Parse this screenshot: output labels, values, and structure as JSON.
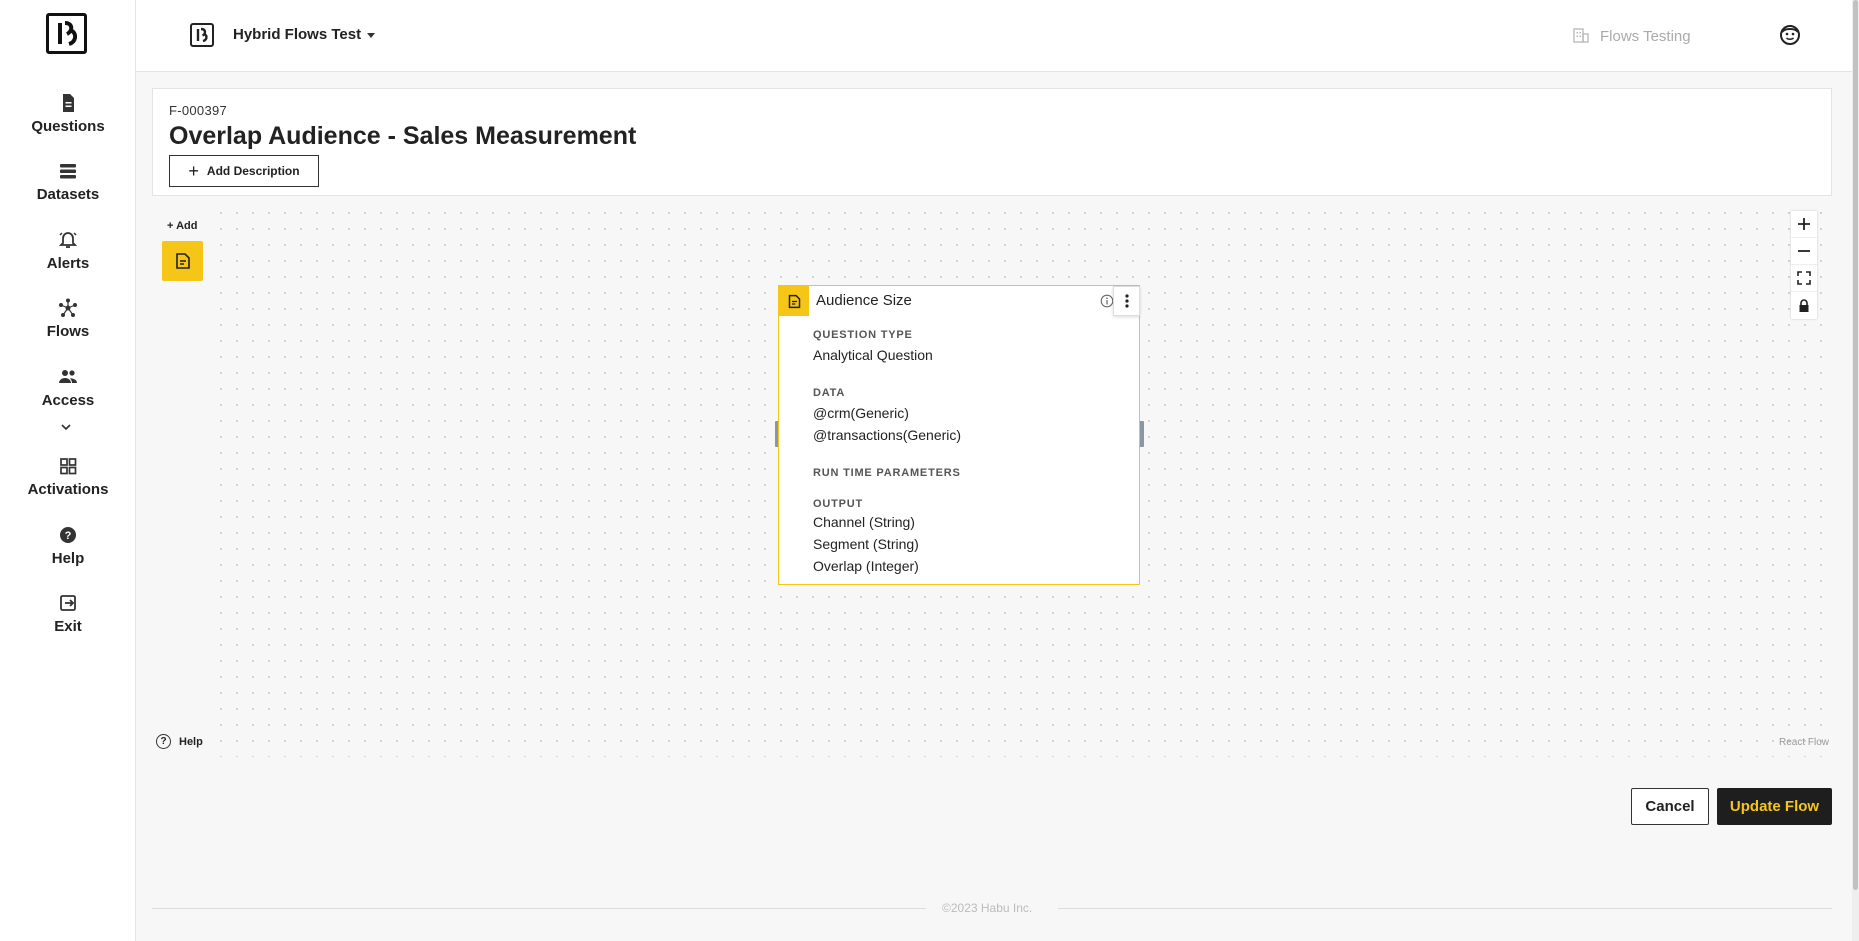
{
  "sidebar": {
    "items": [
      {
        "label": "Questions",
        "icon": "document-icon"
      },
      {
        "label": "Datasets",
        "icon": "stack-icon"
      },
      {
        "label": "Alerts",
        "icon": "bell-icon"
      },
      {
        "label": "Flows",
        "icon": "flows-icon"
      },
      {
        "label": "Access",
        "icon": "people-icon"
      },
      {
        "label": "Activations",
        "icon": "grid-icon"
      },
      {
        "label": "Help",
        "icon": "help-icon"
      },
      {
        "label": "Exit",
        "icon": "exit-icon"
      }
    ]
  },
  "topbar": {
    "org_name": "Hybrid Flows Test",
    "account_name": "Flows Testing"
  },
  "header": {
    "flow_id": "F-000397",
    "title": "Overlap Audience - Sales Measurement",
    "add_description_label": "Add Description"
  },
  "canvas": {
    "add_label": "+ Add",
    "help_label": "Help",
    "attribution": "React Flow",
    "controls": [
      "zoom-in",
      "zoom-out",
      "fit-view",
      "lock"
    ]
  },
  "node": {
    "title": "Audience Size",
    "question_type_label": "QUESTION TYPE",
    "question_type_value": "Analytical Question",
    "data_label": "DATA",
    "data_values": [
      "@crm(Generic)",
      "@transactions(Generic)"
    ],
    "run_time_label": "RUN TIME PARAMETERS",
    "output_label": "OUTPUT",
    "output_values": [
      "Channel (String)",
      "Segment (String)",
      "Overlap (Integer)"
    ]
  },
  "actions": {
    "cancel_label": "Cancel",
    "update_label": "Update Flow"
  },
  "footer": {
    "copyright": "©2023 Habu Inc."
  },
  "colors": {
    "accent": "#f5c518",
    "dark_button": "#1e1e1e"
  }
}
